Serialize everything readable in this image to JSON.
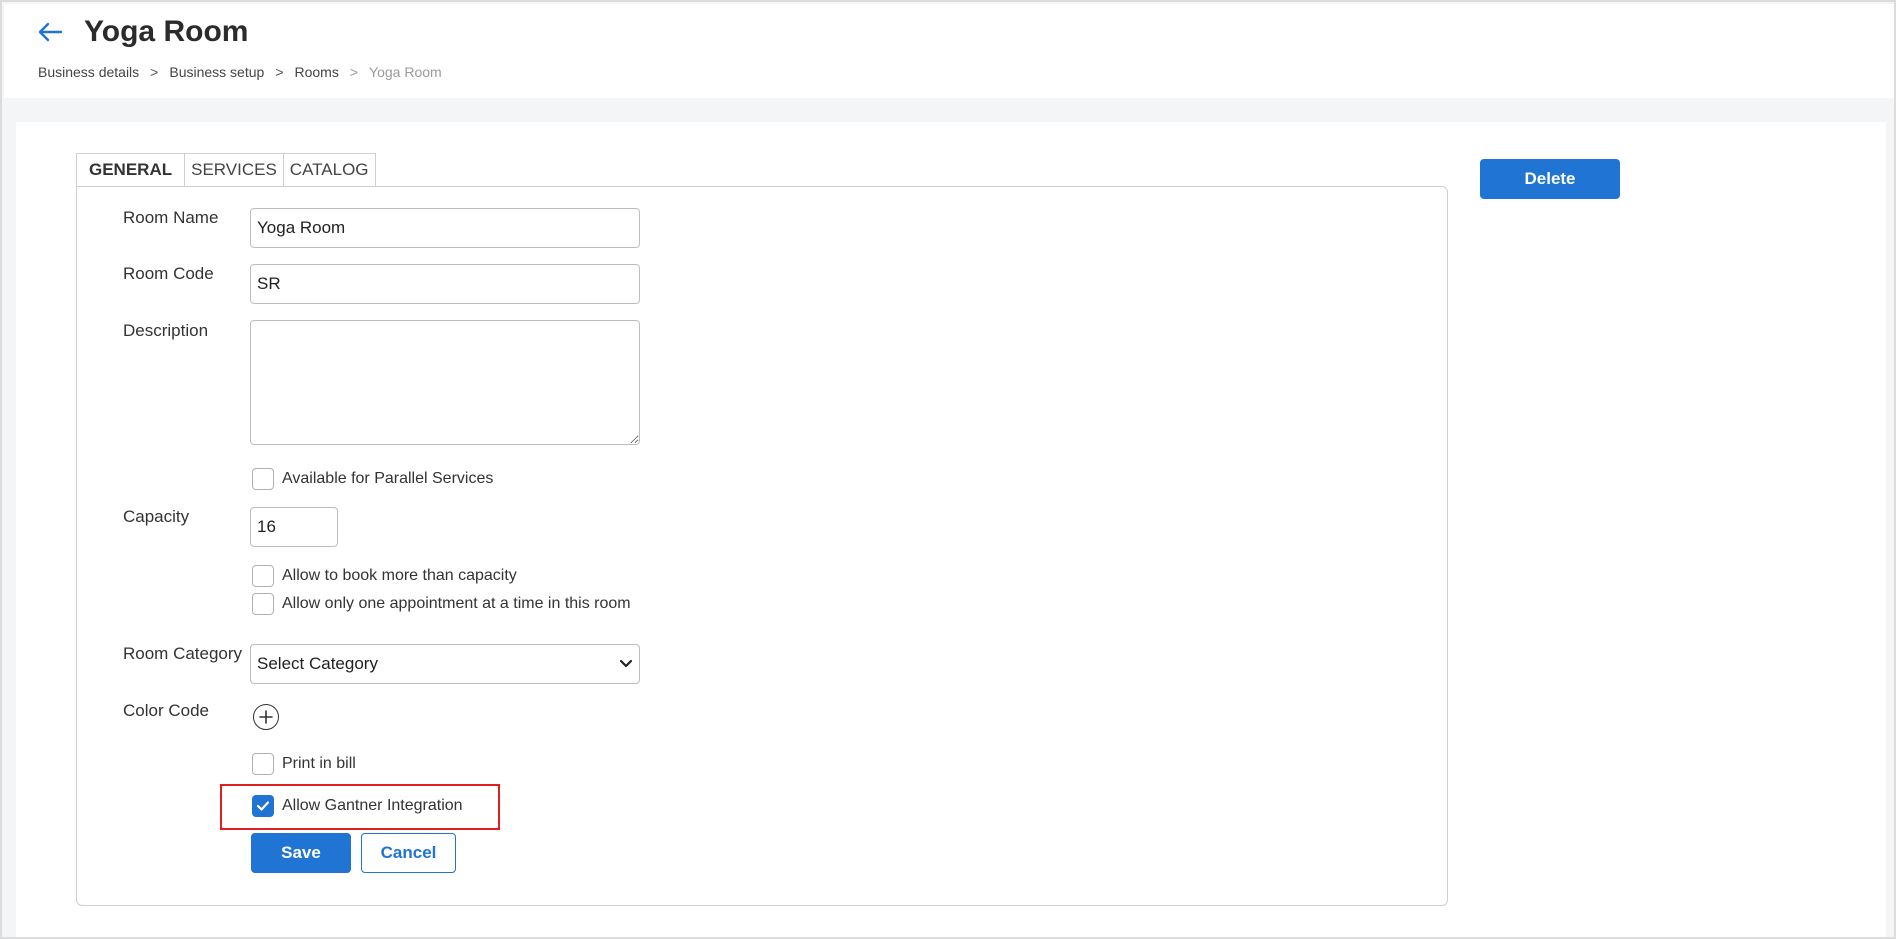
{
  "header": {
    "title": "Yoga Room",
    "breadcrumb": [
      {
        "label": "Business details"
      },
      {
        "label": "Business setup"
      },
      {
        "label": "Rooms"
      },
      {
        "label": "Yoga Room"
      }
    ],
    "breadcrumb_separator": ">"
  },
  "tabs": [
    {
      "label": "GENERAL",
      "active": true
    },
    {
      "label": "SERVICES",
      "active": false
    },
    {
      "label": "CATALOG",
      "active": false
    }
  ],
  "form": {
    "room_name": {
      "label": "Room Name",
      "value": "Yoga Room"
    },
    "room_code": {
      "label": "Room Code",
      "value": "SR"
    },
    "description": {
      "label": "Description",
      "value": ""
    },
    "parallel_services": {
      "label": "Available for Parallel Services",
      "checked": false
    },
    "capacity": {
      "label": "Capacity",
      "value": "16"
    },
    "book_more": {
      "label": "Allow to book more than capacity",
      "checked": false
    },
    "one_appointment": {
      "label": "Allow only one appointment at a time in this room",
      "checked": false
    },
    "room_category": {
      "label": "Room Category",
      "value": "Select Category"
    },
    "color_code": {
      "label": "Color Code"
    },
    "print_in_bill": {
      "label": "Print in bill",
      "checked": false
    },
    "gantner": {
      "label": "Allow Gantner Integration",
      "checked": true
    }
  },
  "buttons": {
    "save": "Save",
    "cancel": "Cancel",
    "delete": "Delete"
  },
  "colors": {
    "accent": "#1f74d4",
    "highlight": "#e02020"
  }
}
